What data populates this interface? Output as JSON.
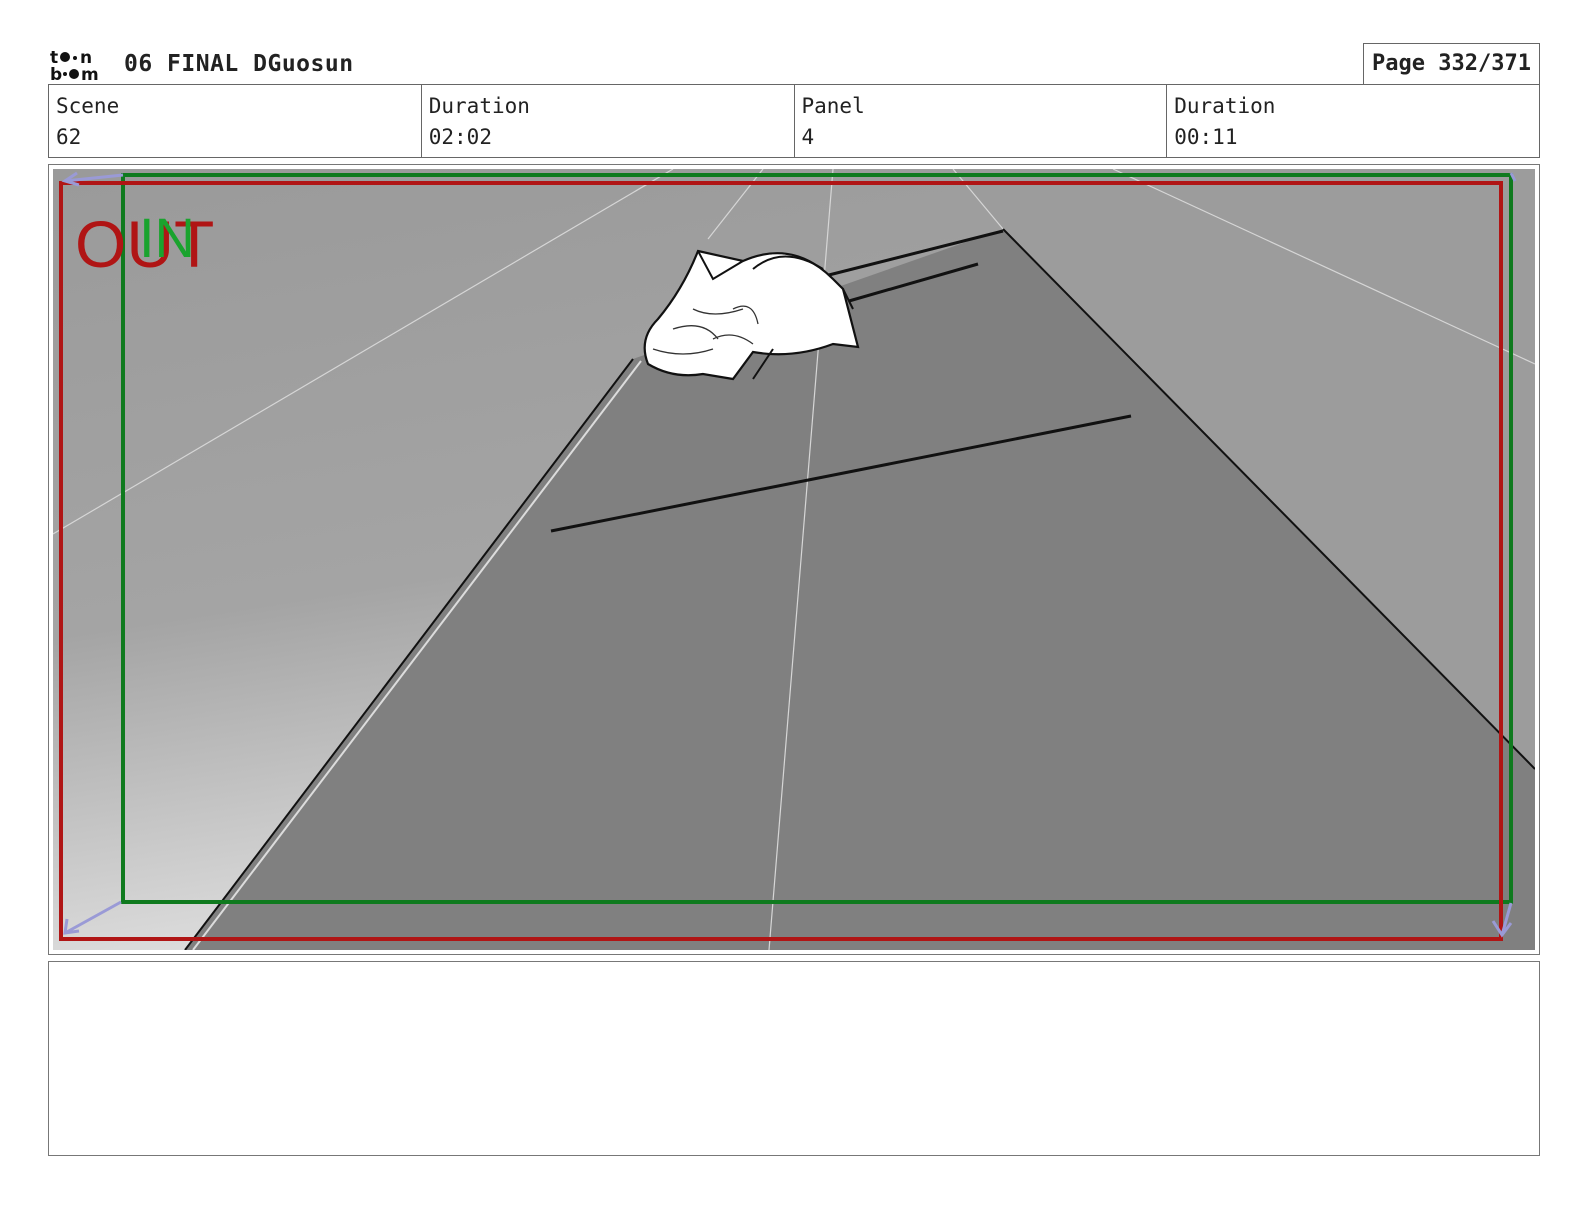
{
  "header": {
    "logo_text": "toon boom",
    "title": "06 FINAL DGuosun",
    "page": "Page 332/371"
  },
  "info": {
    "scene_label": "Scene",
    "scene_value": "62",
    "scene_duration_label": "Duration",
    "scene_duration_value": "02:02",
    "panel_label": "Panel",
    "panel_value": "4",
    "panel_duration_label": "Duration",
    "panel_duration_value": "00:11"
  },
  "panel": {
    "out_label": "OUT",
    "in_label": "IN",
    "colors": {
      "out_frame": "#b01515",
      "in_frame": "#0f7a1e",
      "camera_arrow": "#9a9ad6"
    }
  },
  "notes": {
    "text": ""
  }
}
